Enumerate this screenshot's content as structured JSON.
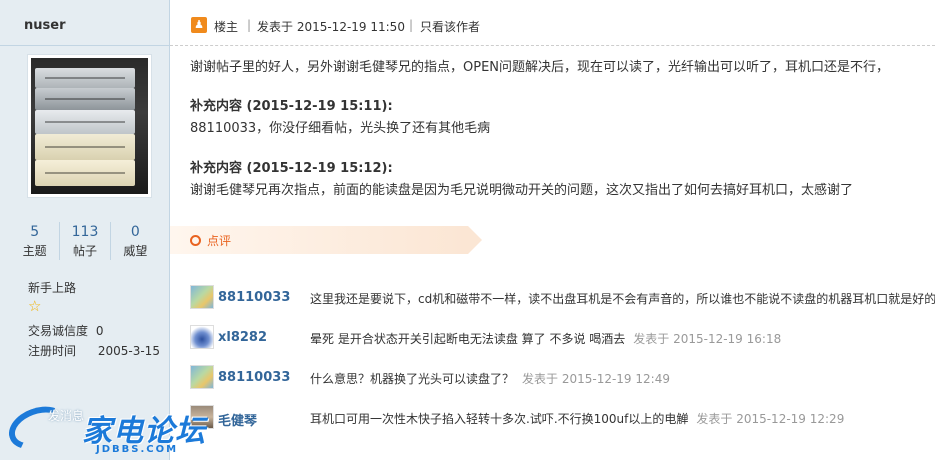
{
  "sidebar": {
    "username": "nuser",
    "stats": [
      {
        "value": "5",
        "label": "主题"
      },
      {
        "value": "113",
        "label": "帖子"
      },
      {
        "value": "0",
        "label": "威望"
      }
    ],
    "rank": "新手上路",
    "credit_label": "交易诚信度",
    "credit_value": "0",
    "reg_label": "注册时间",
    "reg_value": "2005-3-15"
  },
  "post": {
    "author_badge": "楼主",
    "posted_at": "发表于 2015-12-19 11:50",
    "only_author": "只看该作者",
    "body_line1": "谢谢帖子里的好人，另外谢谢毛健琴兄的指点，OPEN问题解决后，现在可以读了，光纤输出可以听了，耳机口还是不行，",
    "supp1_title": "补充内容 (2015-12-19 15:11):",
    "supp1_text": "88110033，你没仔细看帖，光头换了还有其他毛病",
    "supp2_title": "补充内容 (2015-12-19 15:12):",
    "supp2_text": "谢谢毛健琴兄再次指点，前面的能读盘是因为毛兄说明微动开关的问题，这次又指出了如何去搞好耳机口，太感谢了"
  },
  "comments_section": {
    "label": "点评",
    "items": [
      {
        "user": "88110033",
        "text": "这里我还是要说下，cd机和磁带不一样，读不出盘耳机是不会有声音的，所以谁也不能说不读盘的机器耳机口就是好的",
        "time": ""
      },
      {
        "user": "xl8282",
        "text": "晕死 是开合状态开关引起断电无法读盘 算了 不多说 喝酒去",
        "time": "发表于 2015-12-19 16:18"
      },
      {
        "user": "88110033",
        "text": "什么意思？机器换了光头可以读盘了？",
        "time": "发表于 2015-12-19 12:49"
      },
      {
        "user": "毛健琴",
        "text": "耳机口可用一次性木快子掐入轻转十多次.试吓.不行换100uf以上的电觯",
        "time": "发表于 2015-12-19 12:29"
      }
    ]
  },
  "watermark": {
    "main": "家电论坛",
    "sub": "JDBBS.COM",
    "ghost": "发消息"
  }
}
